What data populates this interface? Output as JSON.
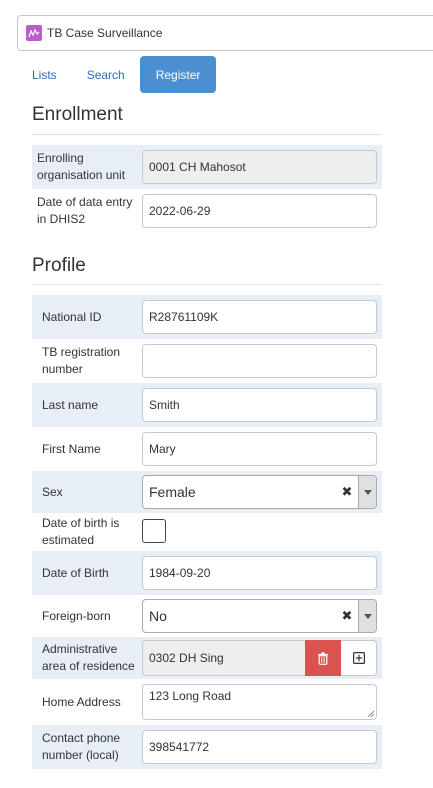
{
  "program": {
    "title": "TB Case Surveillance",
    "icon": "program-icon"
  },
  "tabs": [
    {
      "label": "Lists",
      "active": false
    },
    {
      "label": "Search",
      "active": false
    },
    {
      "label": "Register",
      "active": true
    }
  ],
  "enrollment": {
    "title": "Enrollment",
    "org_unit_label": "Enrolling organisation unit",
    "org_unit_value": "0001 CH Mahosot",
    "entry_date_label": "Date of data entry in DHIS2",
    "entry_date_value": "2022-06-29"
  },
  "profile": {
    "title": "Profile",
    "national_id_label": "National ID",
    "national_id_value": "R28761109K",
    "tb_reg_label": "TB registration number",
    "tb_reg_value": "",
    "last_name_label": "Last name",
    "last_name_value": "Smith",
    "first_name_label": "First Name",
    "first_name_value": "Mary",
    "sex_label": "Sex",
    "sex_value": "Female",
    "dob_estimated_label": "Date of birth is estimated",
    "dob_estimated_checked": false,
    "dob_label": "Date of Birth",
    "dob_value": "1984-09-20",
    "foreign_born_label": "Foreign-born",
    "foreign_born_value": "No",
    "admin_area_label": "Administrative area of residence",
    "admin_area_value": "0302 DH Sing",
    "home_address_label": "Home Address",
    "home_address_value": "123 Long Road",
    "phone_label": "Contact phone number (local)",
    "phone_value": "398541772"
  },
  "colors": {
    "active_tab": "#4a8fd0",
    "link": "#2f6eb5",
    "row_shade": "#e8eef5",
    "delete_button": "#d9534f",
    "program_icon": "#b85fc9"
  }
}
